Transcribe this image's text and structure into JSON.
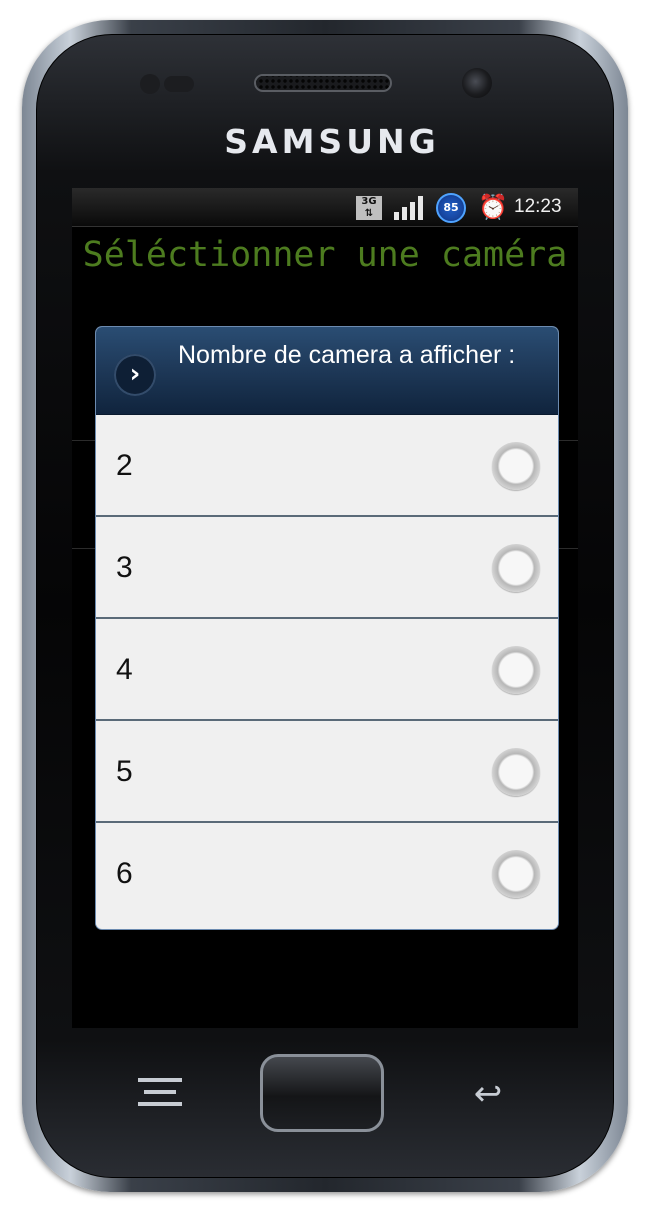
{
  "device": {
    "brand": "SAMSUNG"
  },
  "statusbar": {
    "network_label": "3G",
    "battery_level": "85",
    "time": "12:23",
    "icons": [
      "3g-data-icon",
      "signal-strength-icon",
      "battery-icon",
      "alarm-clock-icon"
    ]
  },
  "page": {
    "title": "Séléctionner une caméra"
  },
  "dialog": {
    "title": "Nombre de camera a afficher :",
    "options": [
      {
        "label": "2",
        "selected": false
      },
      {
        "label": "3",
        "selected": false
      },
      {
        "label": "4",
        "selected": false
      },
      {
        "label": "5",
        "selected": false
      },
      {
        "label": "6",
        "selected": false
      }
    ]
  },
  "colors": {
    "title_text": "#4d7c1f",
    "dialog_header": "#1f3a5a",
    "dialog_body": "#f0f0f0"
  }
}
